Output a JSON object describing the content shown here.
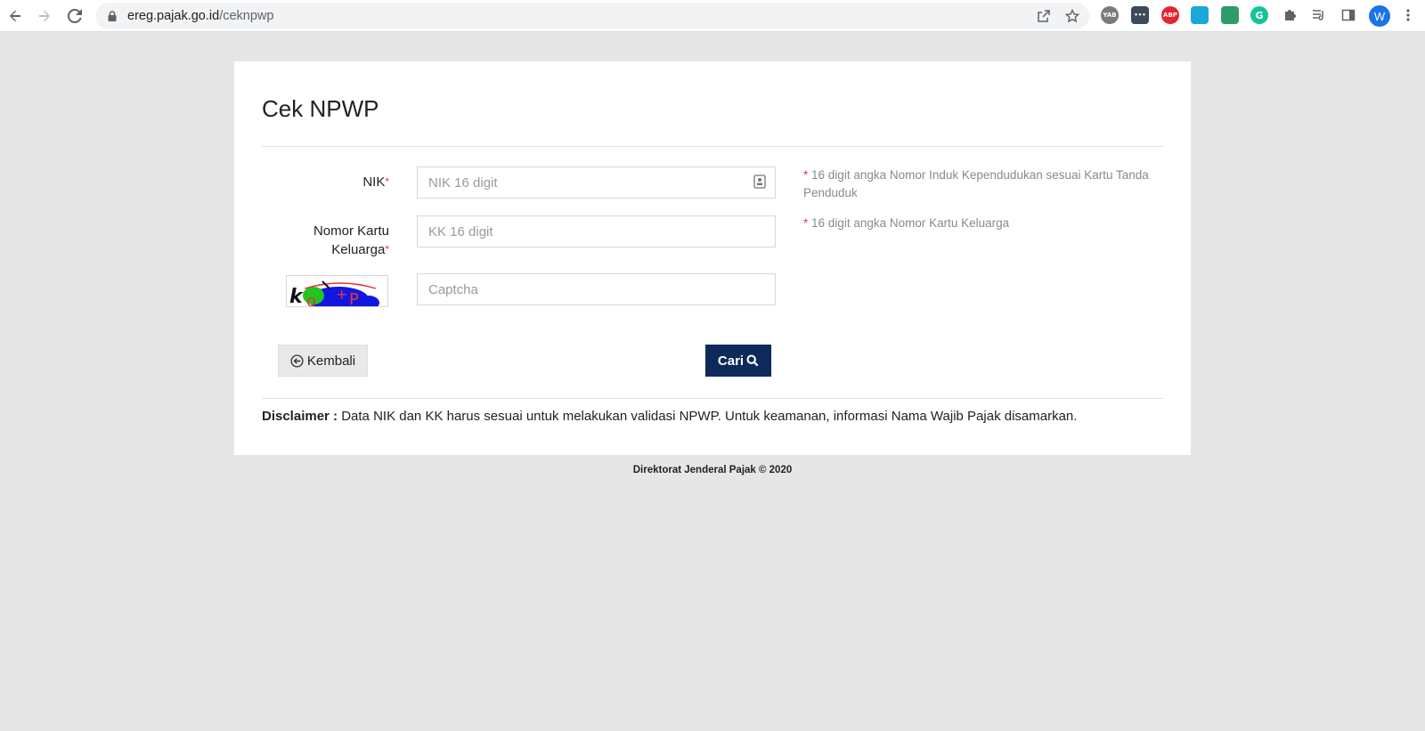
{
  "browser": {
    "url_domain": "ereg.pajak.go.id",
    "url_path": "/ceknpwp",
    "avatar_letter": "W",
    "extensions": [
      {
        "name": "yab-extension-icon",
        "label": "YAB",
        "color": "#7a7a7a"
      },
      {
        "name": "more-extension-icon",
        "label": "•••",
        "color": "#3c4a5a"
      },
      {
        "name": "adblock-icon",
        "label": "ABP",
        "color": "#e8252f"
      },
      {
        "name": "screen-extension-icon",
        "label": "",
        "color": "#1ba8d6"
      },
      {
        "name": "vpn-extension-icon",
        "label": "",
        "color": "#2e9c6a"
      },
      {
        "name": "grammarly-icon",
        "label": "G",
        "color": "#15c39a"
      }
    ]
  },
  "page": {
    "title": "Cek NPWP",
    "fields": {
      "nik": {
        "label": "NIK",
        "placeholder": "NIK 16 digit",
        "help": "16 digit angka Nomor Induk Kependudukan sesuai Kartu Tanda Penduduk"
      },
      "kk": {
        "label_line1": "Nomor Kartu",
        "label_line2": "Keluarga",
        "placeholder": "KK 16 digit",
        "help": "16 digit angka Nomor Kartu Keluarga"
      },
      "captcha": {
        "placeholder": "Captcha"
      }
    },
    "required_marker": "*",
    "buttons": {
      "back": "Kembali",
      "search": "Cari"
    },
    "disclaimer": {
      "label": "Disclaimer :",
      "text": "Data NIK dan KK harus sesuai untuk melakukan validasi NPWP. Untuk keamanan, informasi Nama Wajib Pajak disamarkan."
    }
  },
  "footer": {
    "text": "Direktorat Jenderal Pajak © 2020"
  }
}
